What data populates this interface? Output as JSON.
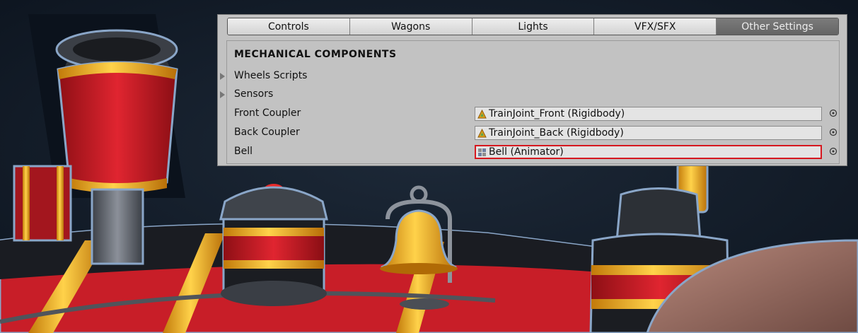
{
  "tabs": [
    {
      "label": "Controls"
    },
    {
      "label": "Wagons"
    },
    {
      "label": "Lights"
    },
    {
      "label": "VFX/SFX"
    },
    {
      "label": "Other Settings",
      "active": true
    }
  ],
  "section": {
    "title": "MECHANICAL COMPONENTS",
    "foldouts": [
      {
        "label": "Wheels Scripts",
        "expanded": false
      },
      {
        "label": "Sensors",
        "expanded": false
      }
    ],
    "fields": [
      {
        "label": "Front Coupler",
        "value": "TrainJoint_Front (Rigidbody)",
        "icon": "rigidbody-icon"
      },
      {
        "label": "Back Coupler",
        "value": "TrainJoint_Back (Rigidbody)",
        "icon": "rigidbody-icon"
      },
      {
        "label": "Bell",
        "value": "Bell (Animator)",
        "icon": "animator-icon",
        "highlighted": true
      }
    ]
  },
  "colors": {
    "panel_bg": "#c2c2c2",
    "active_tab": "#6e6e6e",
    "highlight_border": "#d6181f",
    "scene_bg": "#111a26",
    "locomotive_red": "#d8202a",
    "trim_gold": "#e8a51a"
  }
}
